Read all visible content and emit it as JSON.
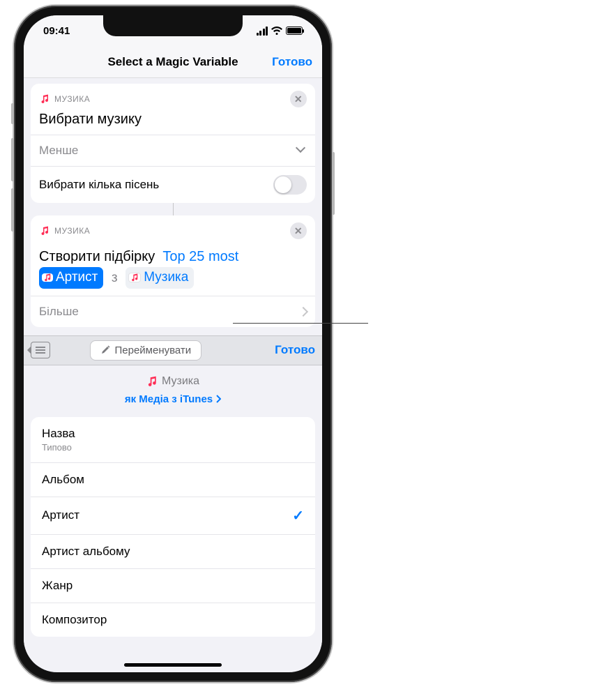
{
  "status": {
    "time": "09:41"
  },
  "nav": {
    "title": "Select a Magic Variable",
    "done": "Готово"
  },
  "card1": {
    "app": "МУЗИКА",
    "title": "Вибрати музику",
    "less": "Менше",
    "multi": "Вибрати кілька пісень"
  },
  "card2": {
    "app": "МУЗИКА",
    "action": "Створити підбірку",
    "playlist": "Top 25 most",
    "chip_artist": "Артист",
    "conj": "з",
    "chip_music": "Музика",
    "more": "Більше"
  },
  "toolbar": {
    "rename": "Перейменувати",
    "done": "Готово"
  },
  "var": {
    "name": "Музика",
    "subtitle": "як Медіа з iTunes"
  },
  "attrs": [
    {
      "label": "Назва",
      "sub": "Типово",
      "selected": false
    },
    {
      "label": "Альбом",
      "selected": false
    },
    {
      "label": "Артист",
      "selected": true
    },
    {
      "label": "Артист альбому",
      "selected": false
    },
    {
      "label": "Жанр",
      "selected": false
    },
    {
      "label": "Композитор",
      "selected": false
    }
  ]
}
